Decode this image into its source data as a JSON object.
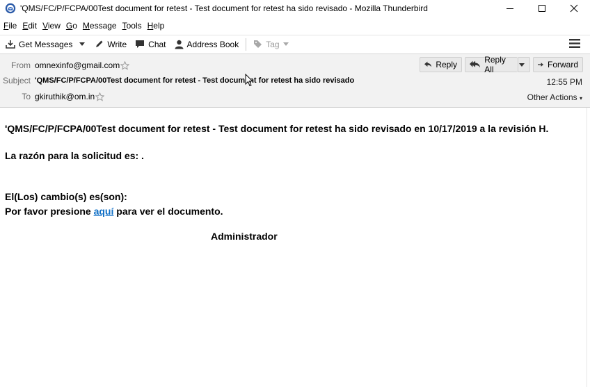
{
  "window": {
    "title": "'QMS/FC/P/FCPA/00Test document for retest - Test document for retest ha sido revisado - Mozilla Thunderbird"
  },
  "menu": [
    "File",
    "Edit",
    "View",
    "Go",
    "Message",
    "Tools",
    "Help"
  ],
  "toolbar": {
    "get_messages": "Get Messages",
    "write": "Write",
    "chat": "Chat",
    "address_book": "Address Book",
    "tag": "Tag"
  },
  "header": {
    "from_label": "From",
    "from_value": "omnexinfo@gmail.com",
    "subject_label": "Subject",
    "subject_value": "'QMS/FC/P/FCPA/00Test document for retest - Test document for retest ha sido revisado",
    "to_label": "To",
    "to_value": "gkiruthik@om.in",
    "reply": "Reply",
    "reply_all": "Reply All",
    "forward": "Forward",
    "time": "12:55 PM",
    "other_actions": "Other Actions"
  },
  "message": {
    "line1": "'QMS/FC/P/FCPA/00Test document for retest - Test document for retest ha sido revisado en 10/17/2019 a la revisión H.",
    "reason": "La razón para la solicitud es: .",
    "changes": "El(Los) cambio(s) es(son):",
    "press_before": "Por favor presione ",
    "link_text": "aquí",
    "press_after": " para ver el documento.",
    "signature": "Administrador"
  },
  "colors": {
    "link": "#0f6fc6",
    "header_bg": "#f2f2f2"
  }
}
